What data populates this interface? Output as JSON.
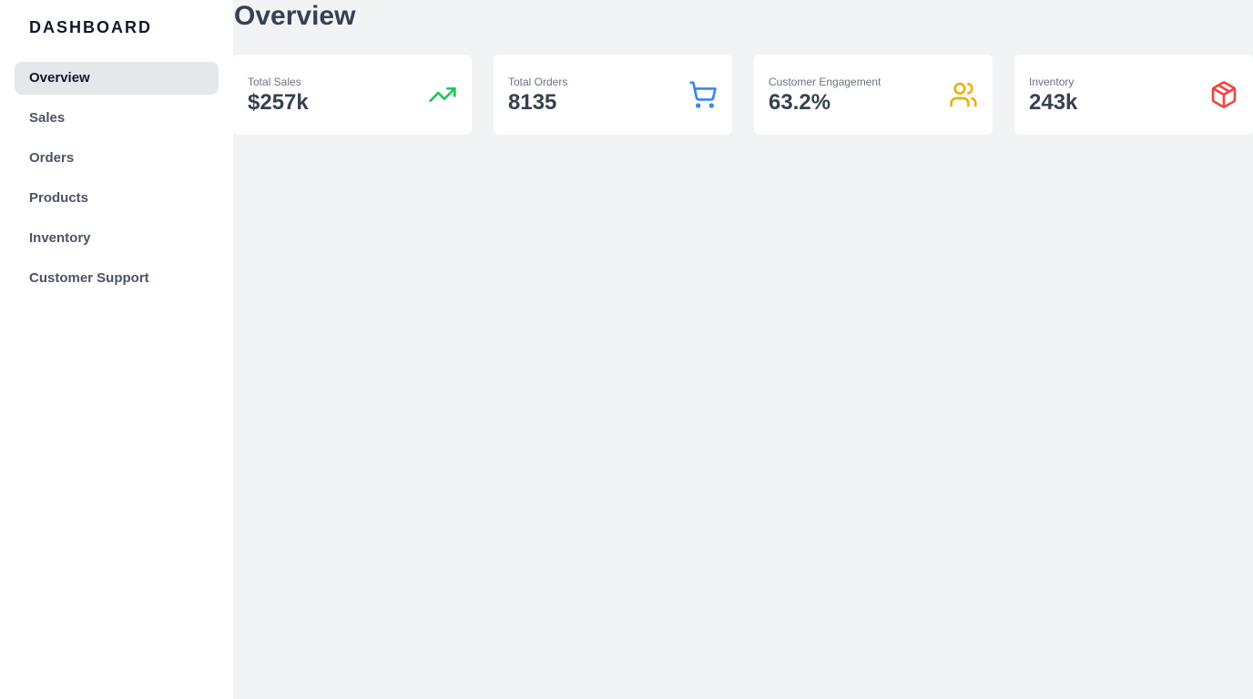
{
  "sidebar": {
    "brand": "DASHBOARD",
    "items": [
      {
        "label": "Overview",
        "active": true
      },
      {
        "label": "Sales",
        "active": false
      },
      {
        "label": "Orders",
        "active": false
      },
      {
        "label": "Products",
        "active": false
      },
      {
        "label": "Inventory",
        "active": false
      },
      {
        "label": "Customer Support",
        "active": false
      }
    ]
  },
  "main": {
    "title": "Overview",
    "cards": [
      {
        "label": "Total Sales",
        "value": "$257k",
        "icon": "trending-up-icon",
        "color": "#22c55e"
      },
      {
        "label": "Total Orders",
        "value": "8135",
        "icon": "shopping-cart-icon",
        "color": "#3b82f6"
      },
      {
        "label": "Customer Engagement",
        "value": "63.2%",
        "icon": "users-icon",
        "color": "#eab308"
      },
      {
        "label": "Inventory",
        "value": "243k",
        "icon": "package-icon",
        "color": "#ef4444"
      }
    ]
  }
}
